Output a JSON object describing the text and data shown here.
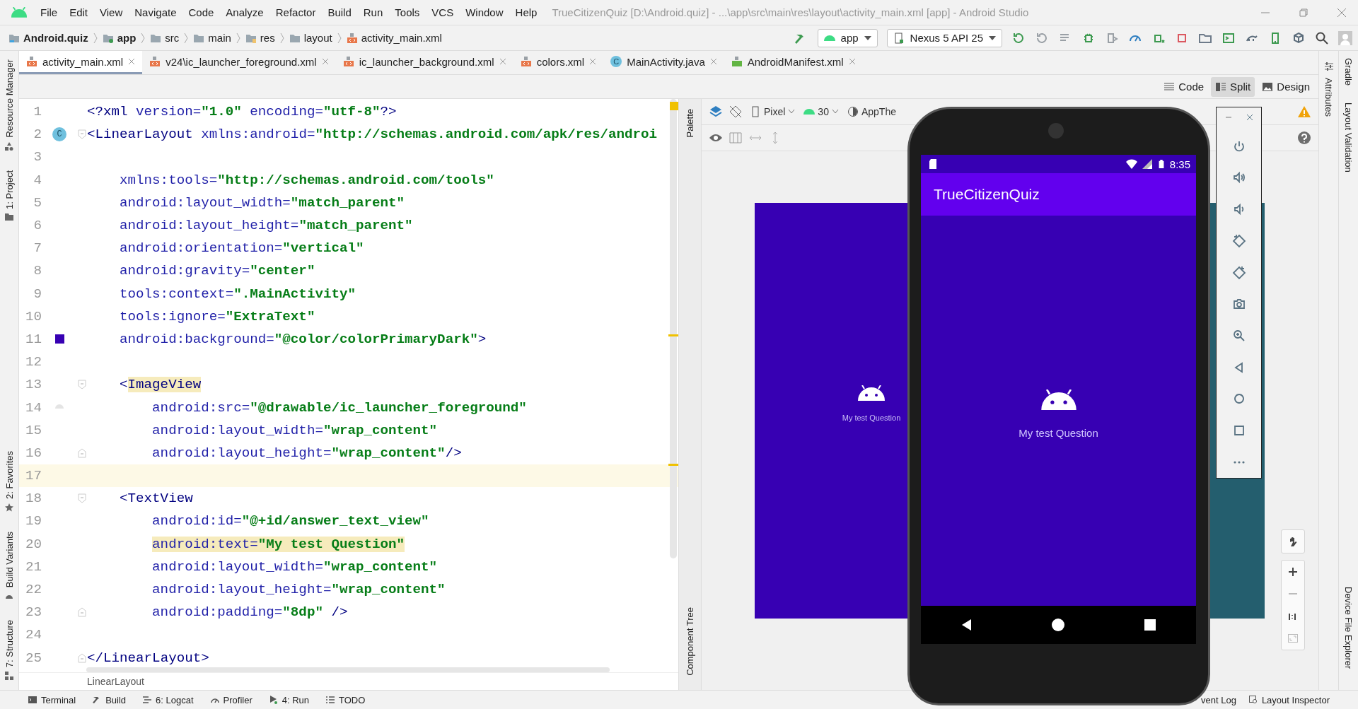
{
  "window": {
    "title": "TrueCitizenQuiz [D:\\Android.quiz] - ...\\app\\src\\main\\res\\layout\\activity_main.xml [app] - Android Studio"
  },
  "menu": [
    "File",
    "Edit",
    "View",
    "Navigate",
    "Code",
    "Analyze",
    "Refactor",
    "Build",
    "Run",
    "Tools",
    "VCS",
    "Window",
    "Help"
  ],
  "breadcrumbs": [
    {
      "label": "Android.quiz",
      "kind": "project"
    },
    {
      "label": "app",
      "kind": "module"
    },
    {
      "label": "src",
      "kind": "folder"
    },
    {
      "label": "main",
      "kind": "folder"
    },
    {
      "label": "res",
      "kind": "res"
    },
    {
      "label": "layout",
      "kind": "folder"
    },
    {
      "label": "activity_main.xml",
      "kind": "xml"
    }
  ],
  "run_config": {
    "module": "app",
    "device": "Nexus 5 API 25"
  },
  "editor_tabs": [
    {
      "label": "activity_main.xml",
      "kind": "xml",
      "selected": true
    },
    {
      "label": "v24\\ic_launcher_foreground.xml",
      "kind": "xml",
      "selected": false
    },
    {
      "label": "ic_launcher_background.xml",
      "kind": "xml",
      "selected": false
    },
    {
      "label": "colors.xml",
      "kind": "xml",
      "selected": false
    },
    {
      "label": "MainActivity.java",
      "kind": "java",
      "badge": "C",
      "selected": false
    },
    {
      "label": "AndroidManifest.xml",
      "kind": "manifest",
      "selected": false
    }
  ],
  "view_modes": [
    {
      "label": "Code",
      "kind": "code",
      "selected": false
    },
    {
      "label": "Split",
      "kind": "split",
      "selected": true
    },
    {
      "label": "Design",
      "kind": "design",
      "selected": false
    }
  ],
  "left_tools": {
    "top": [
      {
        "label": "Resource Manager",
        "kind": "resources"
      },
      {
        "label": "1: Project",
        "kind": "project"
      }
    ],
    "bottom": [
      {
        "label": "2: Favorites",
        "kind": "favorites"
      },
      {
        "label": "Build Variants",
        "kind": "variants"
      },
      {
        "label": "7: Structure",
        "kind": "structure"
      }
    ]
  },
  "right_tools": {
    "top": [
      "Gradle",
      "Layout Validation"
    ],
    "bottom": [
      "Device File Explorer"
    ]
  },
  "attributes_panel": {
    "label": "Attributes"
  },
  "palette": {
    "top": "Palette",
    "bottom": "Component Tree"
  },
  "code": {
    "lines": [
      {
        "number": "1",
        "current": false,
        "kind": "outer",
        "segments": [
          {
            "kind": "tag",
            "text": "<?xml ",
            "highlight": false
          },
          {
            "kind": "attr",
            "text": "version=",
            "highlight": false
          },
          {
            "kind": "value",
            "text": "\"1.0\"",
            "highlight": false
          },
          {
            "kind": "attr",
            "text": " encoding=",
            "highlight": false
          },
          {
            "kind": "value",
            "text": "\"utf-8\"",
            "highlight": false
          },
          {
            "kind": "tag",
            "text": "?>",
            "highlight": false
          }
        ]
      },
      {
        "number": "2",
        "current": false,
        "kind": "outer",
        "fold": {
          "kind": "start"
        },
        "gutter": {
          "kind": "class",
          "badge": "C"
        },
        "segments": [
          {
            "kind": "tag",
            "text": "<LinearLayout ",
            "highlight": false
          },
          {
            "kind": "attr",
            "text": "xmlns:android=",
            "highlight": false
          },
          {
            "kind": "value",
            "text": "\"http://schemas.android.com/apk/res/androi",
            "highlight": false
          }
        ]
      },
      {
        "number": "3",
        "current": false
      },
      {
        "number": "4",
        "current": false,
        "kind": "inner",
        "segments": [
          {
            "kind": "attr",
            "text": "xmlns:tools=",
            "highlight": false
          },
          {
            "kind": "value",
            "text": "\"http://schemas.android.com/tools\"",
            "highlight": false
          }
        ]
      },
      {
        "number": "5",
        "current": false,
        "kind": "inner",
        "segments": [
          {
            "kind": "attr",
            "text": "android:layout_width=",
            "highlight": false
          },
          {
            "kind": "value",
            "text": "\"match_parent\"",
            "highlight": false
          }
        ]
      },
      {
        "number": "6",
        "current": false,
        "kind": "inner",
        "segments": [
          {
            "kind": "attr",
            "text": "android:layout_height=",
            "highlight": false
          },
          {
            "kind": "value",
            "text": "\"match_parent\"",
            "highlight": false
          }
        ]
      },
      {
        "number": "7",
        "current": false,
        "kind": "inner",
        "segments": [
          {
            "kind": "attr",
            "text": "android:orientation=",
            "highlight": false
          },
          {
            "kind": "value",
            "text": "\"vertical\"",
            "highlight": false
          }
        ]
      },
      {
        "number": "8",
        "current": false,
        "kind": "inner",
        "segments": [
          {
            "kind": "attr",
            "text": "android:gravity=",
            "highlight": false
          },
          {
            "kind": "value",
            "text": "\"center\"",
            "highlight": false
          }
        ]
      },
      {
        "number": "9",
        "current": false,
        "kind": "inner",
        "segments": [
          {
            "kind": "attr",
            "text": "tools:context=",
            "highlight": false
          },
          {
            "kind": "value",
            "text": "\".MainActivity\"",
            "highlight": false
          }
        ]
      },
      {
        "number": "10",
        "current": false,
        "kind": "inner",
        "segments": [
          {
            "kind": "attr",
            "text": "tools:ignore=",
            "highlight": false
          },
          {
            "kind": "value",
            "text": "\"ExtraText\"",
            "highlight": false
          }
        ]
      },
      {
        "number": "11",
        "current": false,
        "kind": "inner",
        "gutter": {
          "kind": "color",
          "color": "#3700b3"
        },
        "segments": [
          {
            "kind": "attr",
            "text": "android:background=",
            "highlight": false
          },
          {
            "kind": "value",
            "text": "\"@color/colorPrimaryDark\"",
            "highlight": false
          },
          {
            "kind": "tag",
            "text": ">",
            "highlight": false
          }
        ]
      },
      {
        "number": "12",
        "current": false
      },
      {
        "number": "13",
        "current": false,
        "kind": "inner",
        "fold": {
          "kind": "start"
        },
        "segments": [
          {
            "kind": "tag",
            "text": "<",
            "highlight": false
          },
          {
            "kind": "tag",
            "text": "ImageView",
            "highlight": true
          }
        ]
      },
      {
        "number": "14",
        "current": false,
        "kind": "nested",
        "gutter": {
          "kind": "image"
        },
        "segments": [
          {
            "kind": "attr",
            "text": "android:src=",
            "highlight": false
          },
          {
            "kind": "value",
            "text": "\"@drawable/ic_launcher_foreground\"",
            "highlight": false
          }
        ]
      },
      {
        "number": "15",
        "current": false,
        "kind": "nested",
        "segments": [
          {
            "kind": "attr",
            "text": "android:layout_width=",
            "highlight": false
          },
          {
            "kind": "value",
            "text": "\"wrap_content\"",
            "highlight": false
          }
        ]
      },
      {
        "number": "16",
        "current": false,
        "kind": "nested",
        "fold": {
          "kind": "end"
        },
        "segments": [
          {
            "kind": "attr",
            "text": "android:layout_height=",
            "highlight": false
          },
          {
            "kind": "value",
            "text": "\"wrap_content\"",
            "highlight": false
          },
          {
            "kind": "tag",
            "text": "/>",
            "highlight": false
          }
        ]
      },
      {
        "number": "17",
        "current": true
      },
      {
        "number": "18",
        "current": false,
        "kind": "inner",
        "fold": {
          "kind": "start"
        },
        "segments": [
          {
            "kind": "tag",
            "text": "<TextView",
            "highlight": false
          }
        ]
      },
      {
        "number": "19",
        "current": false,
        "kind": "nested",
        "segments": [
          {
            "kind": "attr",
            "text": "android:id=",
            "highlight": false
          },
          {
            "kind": "value",
            "text": "\"@+id/answer_text_view\"",
            "highlight": false
          }
        ]
      },
      {
        "number": "20",
        "current": false,
        "kind": "nested",
        "segments": [
          {
            "kind": "attr",
            "text": "android:text=",
            "highlight": true
          },
          {
            "kind": "value",
            "text": "\"My test Question\"",
            "highlight": true
          }
        ]
      },
      {
        "number": "21",
        "current": false,
        "kind": "nested",
        "segments": [
          {
            "kind": "attr",
            "text": "android:layout_width=",
            "highlight": false
          },
          {
            "kind": "value",
            "text": "\"wrap_content\"",
            "highlight": false
          }
        ]
      },
      {
        "number": "22",
        "current": false,
        "kind": "nested",
        "segments": [
          {
            "kind": "attr",
            "text": "android:layout_height=",
            "highlight": false
          },
          {
            "kind": "value",
            "text": "\"wrap_content\"",
            "highlight": false
          }
        ]
      },
      {
        "number": "23",
        "current": false,
        "kind": "nested",
        "fold": {
          "kind": "end"
        },
        "segments": [
          {
            "kind": "attr",
            "text": "android:padding=",
            "highlight": false
          },
          {
            "kind": "value",
            "text": "\"8dp\"",
            "highlight": false
          },
          {
            "kind": "tag",
            "text": " />",
            "highlight": false
          }
        ]
      },
      {
        "number": "24",
        "current": false
      },
      {
        "number": "25",
        "current": false,
        "kind": "outer",
        "fold": {
          "kind": "end"
        },
        "segments": [
          {
            "kind": "tag",
            "text": "</LinearLayout>",
            "highlight": false
          }
        ]
      }
    ]
  },
  "editor_breadcrumb": "LinearLayout",
  "design": {
    "device": "Pixel",
    "api": "30",
    "theme": "AppThe",
    "preview_text": "My test Question"
  },
  "emulator": {
    "time": "8:35",
    "app_title": "TrueCitizenQuiz",
    "text": "My test Question"
  },
  "bottom_tools": {
    "left": [
      {
        "label": "Terminal",
        "kind": "terminal"
      },
      {
        "label": "Build",
        "kind": "build"
      },
      {
        "label": "6: Logcat",
        "kind": "logcat"
      },
      {
        "label": "Profiler",
        "kind": "profiler"
      },
      {
        "label": "4: Run",
        "kind": "run"
      },
      {
        "label": "TODO",
        "kind": "todo"
      }
    ],
    "right": [
      {
        "label": "vent Log",
        "kind": "eventlog"
      },
      {
        "label": "Layout Inspector",
        "kind": "inspector"
      }
    ]
  }
}
